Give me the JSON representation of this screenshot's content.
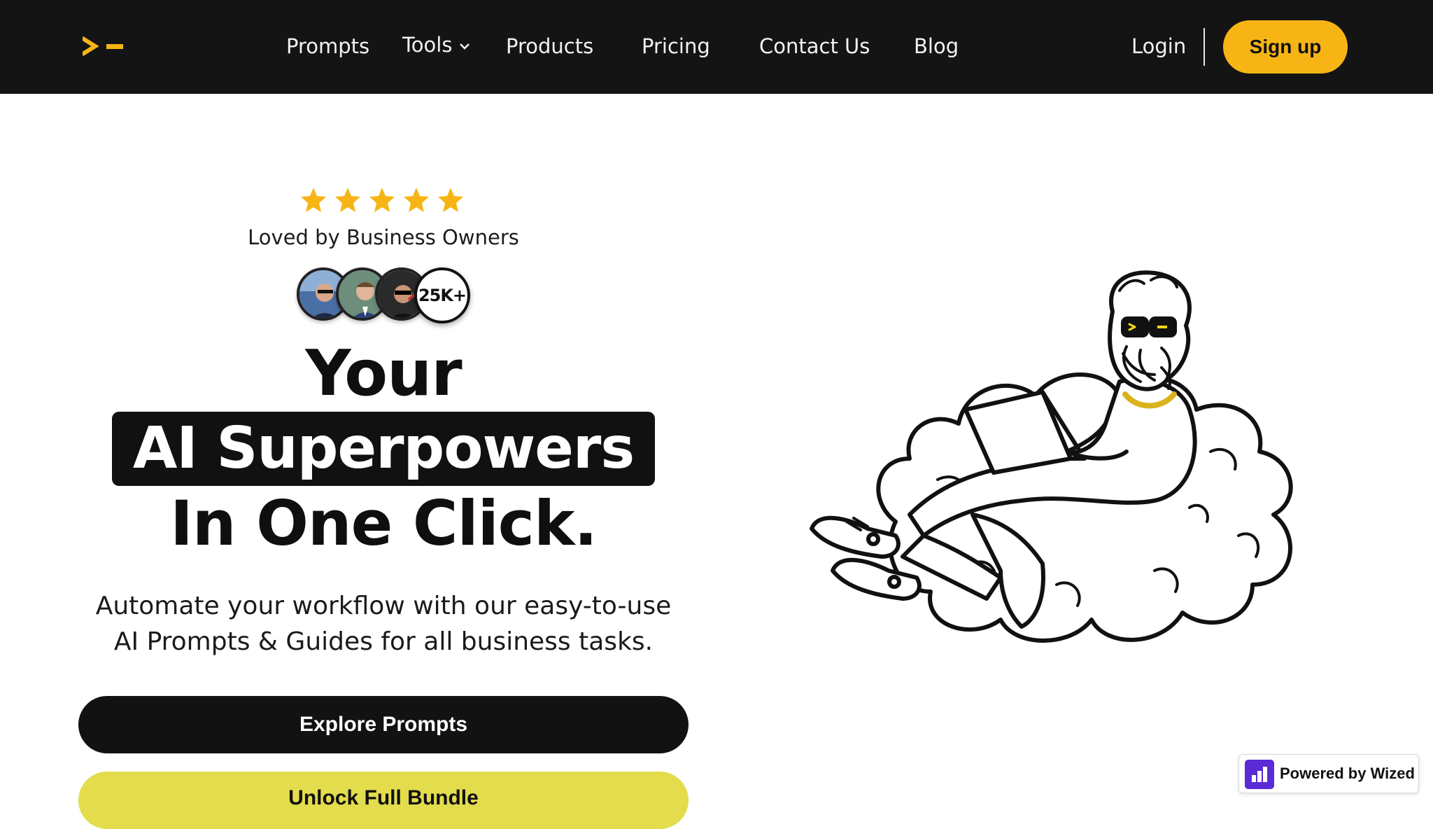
{
  "nav": {
    "logo_icon": "terminal-prompt-logo",
    "items": [
      "Prompts",
      "Tools",
      "Products",
      "Pricing",
      "Contact Us",
      "Blog"
    ],
    "login": "Login",
    "signup": "Sign up"
  },
  "hero": {
    "rating": {
      "stars": 5,
      "max": 5
    },
    "tagline": "Loved by Business Owners",
    "user_count": "25K+",
    "headline_1": "Your",
    "headline_2": "AI Superpowers",
    "headline_3": "In One Click.",
    "subtitle_1": "Automate your workflow with our easy-to-use",
    "subtitle_2": "AI Prompts & Guides for all business tasks.",
    "cta_primary": "Explore Prompts",
    "cta_secondary": "Unlock Full Bundle"
  },
  "badge": {
    "text": "Powered by Wized"
  },
  "colors": {
    "nav_bg": "#141414",
    "accent_yellow": "#f7b515",
    "bundle_yellow": "#e3dc4c",
    "dark": "#121212",
    "wized_purple": "#5b2bd6"
  }
}
